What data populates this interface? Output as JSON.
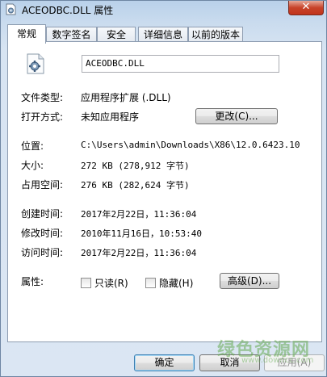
{
  "window": {
    "title": "ACEODBC.DLL 属性",
    "close_glyph": "✕"
  },
  "tabs": [
    {
      "label": "常规",
      "active": true
    },
    {
      "label": "数字签名",
      "active": false
    },
    {
      "label": "安全",
      "active": false
    },
    {
      "label": "详细信息",
      "active": false
    },
    {
      "label": "以前的版本",
      "active": false
    }
  ],
  "general": {
    "file_name": "ACEODBC.DLL",
    "file_type_label": "文件类型:",
    "file_type_value": "应用程序扩展 (.DLL)",
    "open_with_label": "打开方式:",
    "open_with_value": "未知应用程序",
    "change_button": "更改(C)...",
    "location_label": "位置:",
    "location_value": "C:\\Users\\admin\\Downloads\\X86\\12.0.6423.10",
    "size_label": "大小:",
    "size_value": "272 KB (278,912 字节)",
    "disk_size_label": "占用空间:",
    "disk_size_value": "276 KB (282,624 字节)",
    "created_label": "创建时间:",
    "created_value": "2017年2月22日，11:36:04",
    "modified_label": "修改时间:",
    "modified_value": "2010年11月16日，10:53:40",
    "accessed_label": "访问时间:",
    "accessed_value": "2017年2月22日，11:36:04",
    "attributes_label": "属性:",
    "readonly_label": "只读(R)",
    "readonly_checked": false,
    "hidden_label": "隐藏(H)",
    "hidden_checked": false,
    "advanced_button": "高级(D)..."
  },
  "footer": {
    "ok": "确定",
    "cancel": "取消",
    "apply": "应用(A)"
  },
  "watermark": {
    "main": "绿色资源网",
    "sub": "www.downcc.com"
  },
  "colors": {
    "accent": "#3c7fb1",
    "close": "#c7432a"
  },
  "icons": {
    "app": "dll-file-icon",
    "file": "gear-document-icon"
  }
}
